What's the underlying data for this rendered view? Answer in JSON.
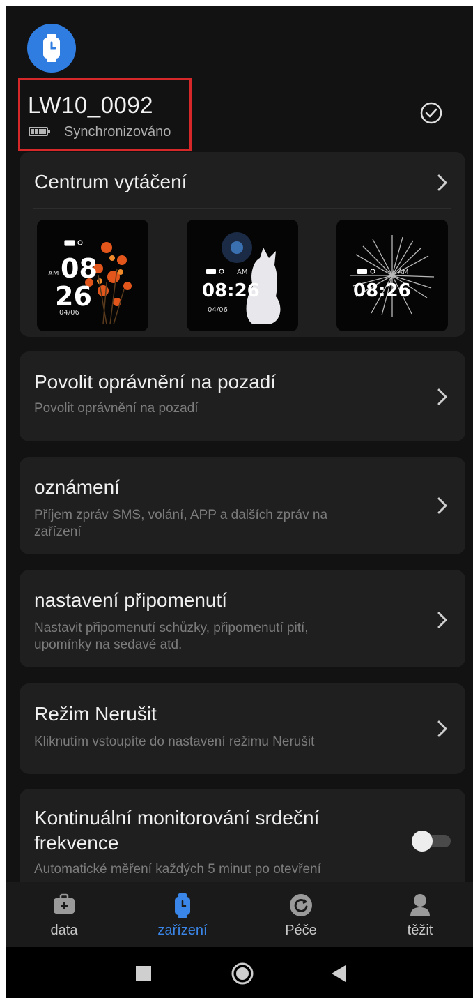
{
  "header": {
    "device_name": "LW10_0092",
    "status": "Synchronizováno"
  },
  "dial_center": {
    "title": "Centrum vytáčení",
    "faces": [
      {
        "ampm": "AM",
        "hour": "08",
        "minute": "26",
        "date": "04/06"
      },
      {
        "ampm": "AM",
        "time": "08:26",
        "date": "04/06"
      },
      {
        "ampm": "AM",
        "time": "08:26"
      }
    ]
  },
  "settings": [
    {
      "title": "Povolit oprávnění na pozadí",
      "subtitle": "Povolit oprávnění na pozadí"
    },
    {
      "title": "oznámení",
      "subtitle": "Příjem zpráv SMS, volání, APP a dalších zpráv na zařízení"
    },
    {
      "title": "nastavení připomenutí",
      "subtitle": "Nastavit připomenutí schůzky, připomenutí pití, upomínky na sedavé atd."
    },
    {
      "title": "Režim Nerušit",
      "subtitle": "Kliknutím vstoupíte do nastavení režimu Nerušit"
    },
    {
      "title": "Kontinuální monitorování srdeční frekvence",
      "subtitle": "Automatické měření každých 5 minut po otevření",
      "toggle_on": false
    }
  ],
  "bottom_nav": {
    "active": "zařízení",
    "items": [
      {
        "label": "data",
        "icon": "briefcase-icon"
      },
      {
        "label": "zařízení",
        "icon": "watch-icon"
      },
      {
        "label": "Péče",
        "icon": "care-icon"
      },
      {
        "label": "těžit",
        "icon": "person-icon"
      }
    ]
  },
  "colors": {
    "background": "#121212",
    "card": "#1f1f1f",
    "accent": "#2f7de1",
    "highlight": "#d62828"
  }
}
